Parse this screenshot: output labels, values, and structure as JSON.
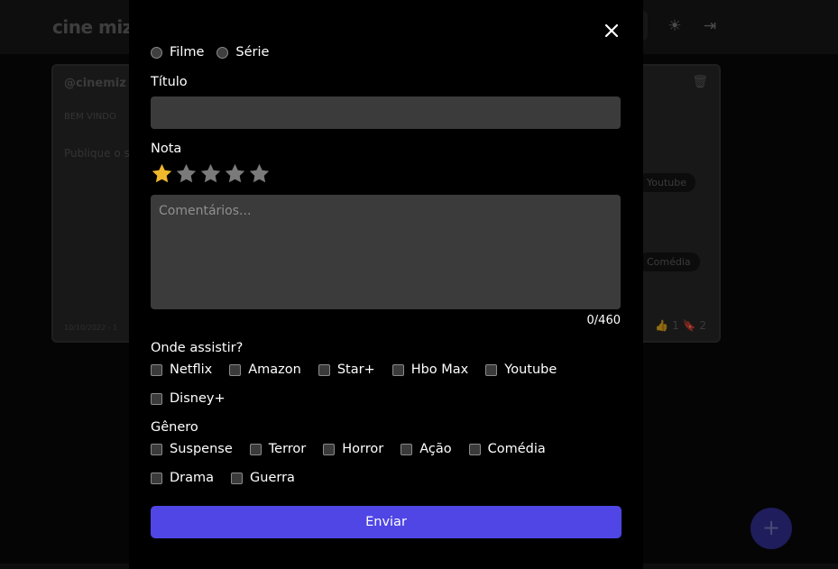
{
  "background": {
    "logo": "cine mize",
    "post_user": "@cinemiz",
    "post_welcome": "BEM VINDO",
    "post_text": "Publique o selecione o disponível",
    "post_date": "10/10/2022 - 1",
    "tag_youtube": "Youtube",
    "tag_comedia": "Comédia",
    "likes": "1",
    "saves": "2",
    "fab_label": "+"
  },
  "modal": {
    "type_options": [
      {
        "label": "Filme"
      },
      {
        "label": "Série"
      }
    ],
    "title_label": "Título",
    "title_value": "",
    "rating_label": "Nota",
    "rating": 1,
    "rating_max": 5,
    "comments_placeholder": "Comentários...",
    "comments_value": "",
    "counter": "0/460",
    "where_label": "Onde assistir?",
    "platforms_row1": [
      "Netflix",
      "Amazon",
      "Star+",
      "Hbo Max",
      "Youtube"
    ],
    "platforms_row2": [
      "Disney+"
    ],
    "genre_label": "Gênero",
    "genres_row1": [
      "Suspense",
      "Terror",
      "Horror",
      "Ação",
      "Comédia"
    ],
    "genres_row2": [
      "Drama",
      "Guerra"
    ],
    "submit_label": "Enviar"
  },
  "colors": {
    "accent": "#4f46e5",
    "star_active": "#f0b82c",
    "star_inactive": "#7a7a7a",
    "input_bg": "#3b3b3b"
  }
}
